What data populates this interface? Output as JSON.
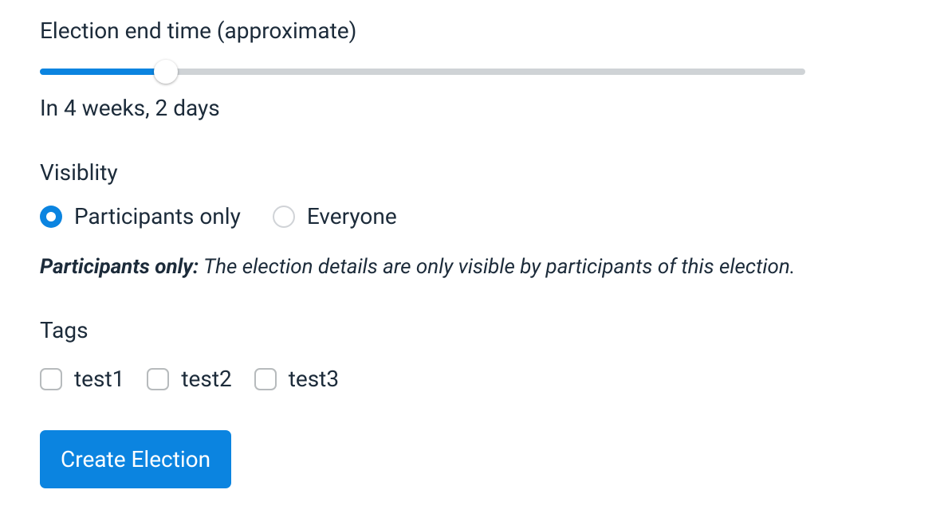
{
  "endTime": {
    "label": "Election end time (approximate)",
    "sliderPercent": 16.5,
    "valueText": "In 4 weeks, 2 days"
  },
  "visibility": {
    "label": "Visiblity",
    "options": [
      {
        "id": "participants",
        "label": "Participants only",
        "selected": true
      },
      {
        "id": "everyone",
        "label": "Everyone",
        "selected": false
      }
    ],
    "description": {
      "prefix": "Participants only:",
      "text": " The election details are only visible by participants of this election."
    }
  },
  "tags": {
    "label": "Tags",
    "items": [
      {
        "label": "test1",
        "checked": false
      },
      {
        "label": "test2",
        "checked": false
      },
      {
        "label": "test3",
        "checked": false
      }
    ]
  },
  "submit": {
    "label": "Create Election"
  }
}
